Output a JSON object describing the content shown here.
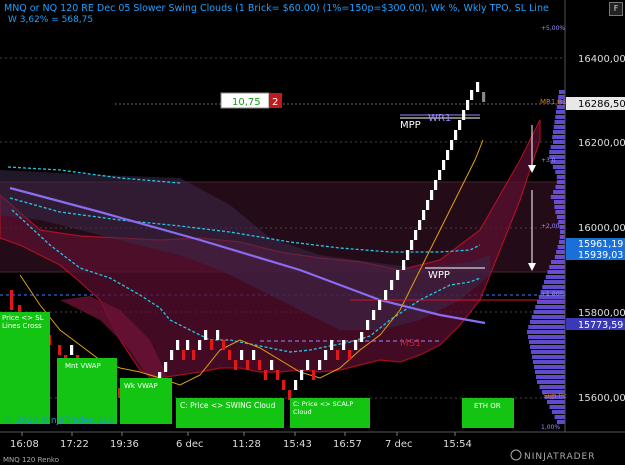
{
  "header": {
    "title": "MNQ or NQ 120 RE Dec 05 Slower Swing Clouds (1 Brick= $60.00) (1%=150p=$300.00), Wk %, Wkly TPO, SL Line",
    "subtitle": "W 3,62% = 568,75",
    "close_label": "F"
  },
  "price_axis": {
    "ticks": [
      "16400,00",
      "16200,00",
      "16000,00",
      "15800,00",
      "15600,00"
    ],
    "pct_labels": [
      "+5,00%",
      "+3,0",
      "+2,00",
      "+1,00%",
      "1,00%"
    ],
    "last_price": "16286,50",
    "tag_a": "15961,19",
    "tag_b": "15939,03",
    "tag_c": "15773,59"
  },
  "time_axis": {
    "ticks": [
      "16:08",
      "17:22",
      "19:36",
      "6 dec",
      "11:28",
      "15:43",
      "16:57",
      "7 dec",
      "15:54"
    ]
  },
  "position_box": {
    "value": "10,75",
    "qty": "2"
  },
  "annotations": {
    "mpp": "MPP",
    "wr1": "WR1",
    "wpp": "WPP",
    "ms1": "MS1",
    "mr1": "MR1 R1",
    "sup": "Sup Pc"
  },
  "signal_boxes": [
    {
      "label": "Price <> SL Lines Cross"
    },
    {
      "label": "Mnt VWAP"
    },
    {
      "label": "Wk VWAP"
    },
    {
      "label": "C: Price <> SWING Cloud"
    },
    {
      "label": "C: Price <> SCALP Cloud"
    },
    {
      "label": "ETH OR"
    }
  ],
  "footer": {
    "copyright": "© 2021 NinjaTrader, LLC",
    "instrument": "MNQ 120 Renko",
    "brand": "NINJATRADER"
  },
  "colors": {
    "background": "#000000",
    "up_brick": "#ffffff",
    "down_brick": "#e01818",
    "cloud": "#8a1a55",
    "signal_green": "#13c413",
    "title_blue": "#1ea0ff",
    "tpo_purple": "#7b5cff"
  }
}
